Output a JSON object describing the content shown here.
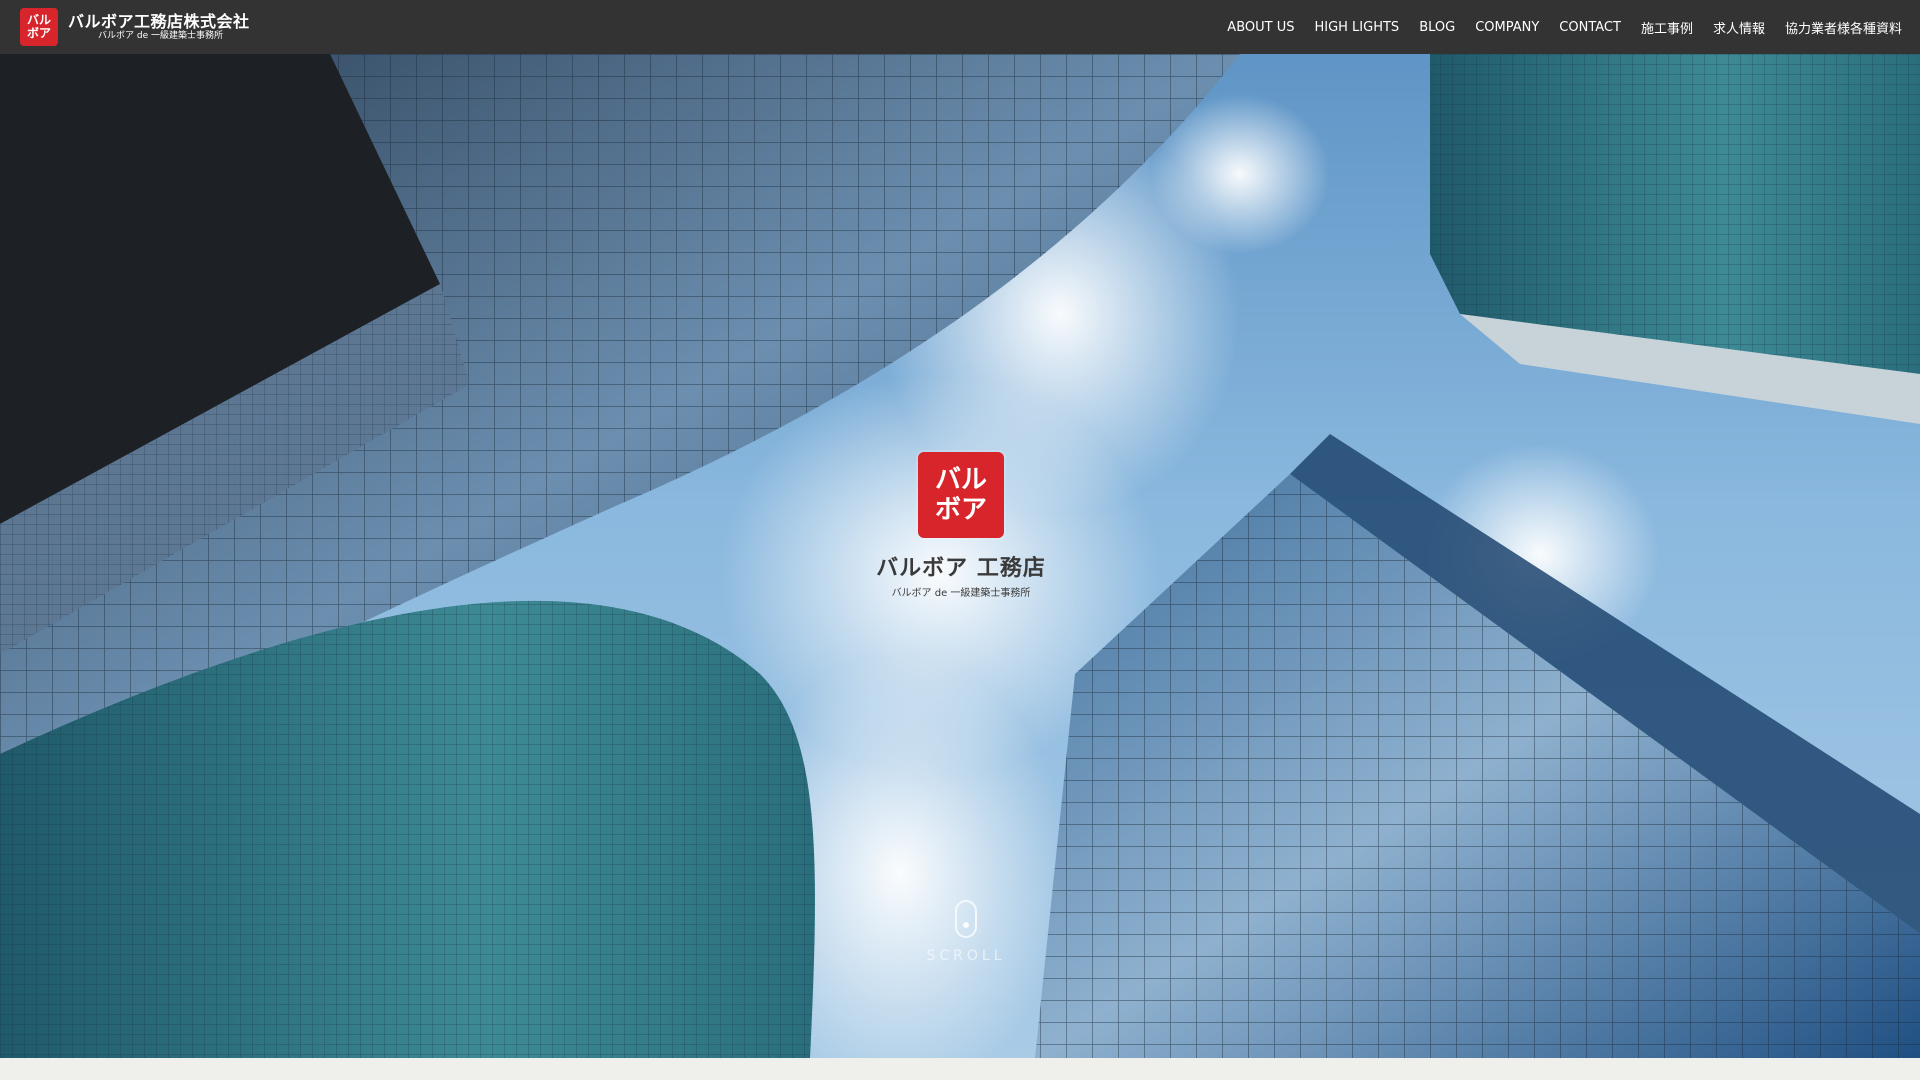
{
  "header": {
    "brand_mark_line1": "バル",
    "brand_mark_line2": "ボア",
    "brand_name": "バルボア工務店株式会社",
    "brand_sub": "バルボア de 一級建築士事務所"
  },
  "nav": {
    "items": [
      {
        "label": "ABOUT US"
      },
      {
        "label": "HIGH LIGHTS"
      },
      {
        "label": "BLOG"
      },
      {
        "label": "COMPANY"
      },
      {
        "label": "CONTACT"
      },
      {
        "label": "施工事例"
      },
      {
        "label": "求人情報"
      },
      {
        "label": "協力業者様各種資料"
      }
    ]
  },
  "hero": {
    "logo_mark_line1": "バル",
    "logo_mark_line2": "ボア",
    "logo_name": "バルボア 工務店",
    "logo_sub": "バルボア de 一級建築士事務所",
    "scroll_label": "SCROLL"
  },
  "colors": {
    "header_bg": "#333333",
    "brand_red": "#d7252b",
    "sky": "#8ab8de"
  },
  "icons": {
    "scroll": "mouse-icon"
  }
}
